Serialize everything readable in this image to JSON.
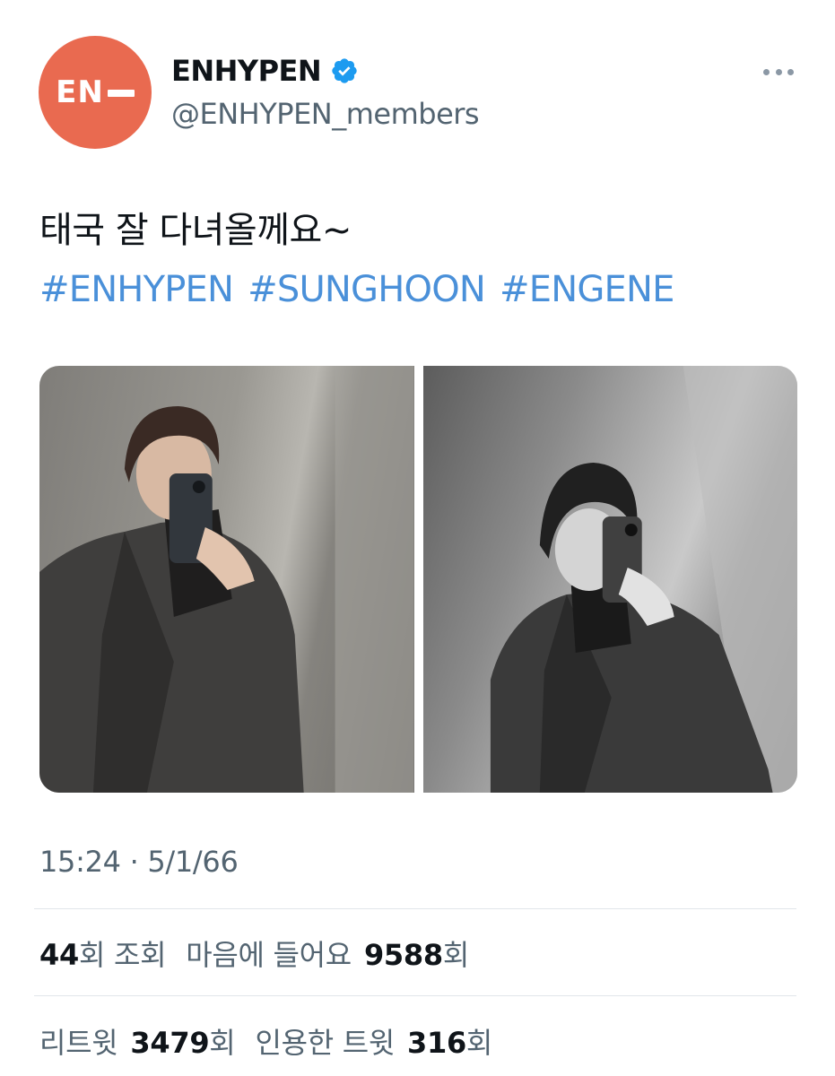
{
  "account": {
    "avatar_text": "EN",
    "display_name": "ENHYPEN",
    "handle": "@ENHYPEN_members",
    "verified": true,
    "avatar_color": "#e96a50",
    "verified_color": "#1d9bf0"
  },
  "tweet": {
    "text": "태국 잘 다녀올께요~",
    "hashtags": [
      "#ENHYPEN",
      "#SUNGHOON",
      "#ENGENE"
    ],
    "hashtag_color": "#4a90d9",
    "media": [
      {
        "icon": "photo-color-icon"
      },
      {
        "icon": "photo-bw-icon"
      }
    ],
    "timestamp": "15:24 · 5/1/66"
  },
  "stats": {
    "views_count": "44",
    "views_suffix": "회 조회",
    "likes_label": "마음에 들어요",
    "likes_count": "9588",
    "likes_suffix": "회",
    "retweets_label": "리트윗",
    "retweets_count": "3479",
    "retweets_suffix": "회",
    "quotes_label": "인용한 트윗",
    "quotes_count": "316",
    "quotes_suffix": "회"
  }
}
